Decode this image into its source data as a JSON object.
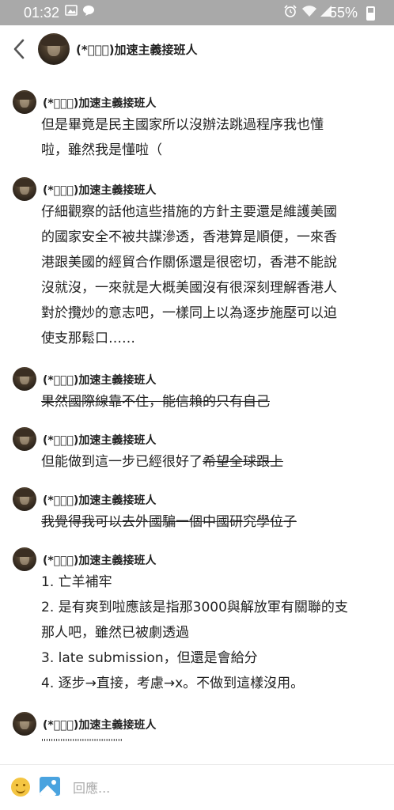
{
  "status_bar": {
    "time": "01:32",
    "icons": [
      "gallery-icon",
      "chat-bubble-icon",
      "alarm-icon",
      "wifi-icon",
      "signal-icon"
    ],
    "battery": "55%"
  },
  "header": {
    "back_icon": "back-arrow-icon",
    "title": "(*ﾟーﾟ)加速主義接班人"
  },
  "messages": [
    {
      "author": "(*ﾟーﾟ)加速主義接班人",
      "lines": [
        {
          "text": "但是畢竟是民主國家所以沒辦法跳過程序我也懂",
          "strike": false
        },
        {
          "text": "啦，雖然我是懂啦（",
          "strike": false
        }
      ]
    },
    {
      "author": "(*ﾟーﾟ)加速主義接班人",
      "lines": [
        {
          "text": "仔細觀察的話他這些措施的方針主要還是維護美國",
          "strike": false
        },
        {
          "text": "的國家安全不被共諜滲透，香港算是順便，一來香",
          "strike": false
        },
        {
          "text": "港跟美國的經貿合作關係還是很密切，香港不能說",
          "strike": false
        },
        {
          "text": "沒就沒，一來就是大概美國沒有很深刻理解香港人",
          "strike": false
        },
        {
          "text": "對於攬炒的意志吧，一樣同上以為逐步施壓可以迫",
          "strike": false
        },
        {
          "text": "使支那鬆口……",
          "strike": false
        }
      ]
    },
    {
      "author": "(*ﾟーﾟ)加速主義接班人",
      "lines": [
        {
          "text": "果然國際線靠不住，能信賴的只有自己",
          "strike": true
        }
      ]
    },
    {
      "author": "(*ﾟーﾟ)加速主義接班人",
      "lines": [
        {
          "text": "但能做到這一步已經很好了",
          "strike": false,
          "strike_tail": "希望全球跟上"
        }
      ]
    },
    {
      "author": "(*ﾟーﾟ)加速主義接班人",
      "lines": [
        {
          "text": "我覺得我可以去外國騙一個中國研究學位子",
          "strike": true
        }
      ]
    },
    {
      "author": "(*ﾟーﾟ)加速主義接班人",
      "lines": [
        {
          "text": "1. 亡羊補牢",
          "strike": false
        },
        {
          "text": "2. 是有爽到啦應該是指那3000與解放軍有關聯的支",
          "strike": false
        },
        {
          "text": "那人吧，雖然已被劇透過",
          "strike": false
        },
        {
          "text": "3. late submission，但還是會給分",
          "strike": false
        },
        {
          "text": "4. 逐步→直接，考慮→x。不做到這樣沒用。",
          "strike": false
        }
      ]
    },
    {
      "author": "(*ﾟーﾟ)加速主義接班人",
      "lines": [
        {
          "text": "''''''''''''''''''''''''''''''''''",
          "strike": false
        }
      ]
    }
  ],
  "composer": {
    "emoji_icon": "emoji-icon",
    "image_icon": "image-icon",
    "placeholder": "回應..."
  }
}
